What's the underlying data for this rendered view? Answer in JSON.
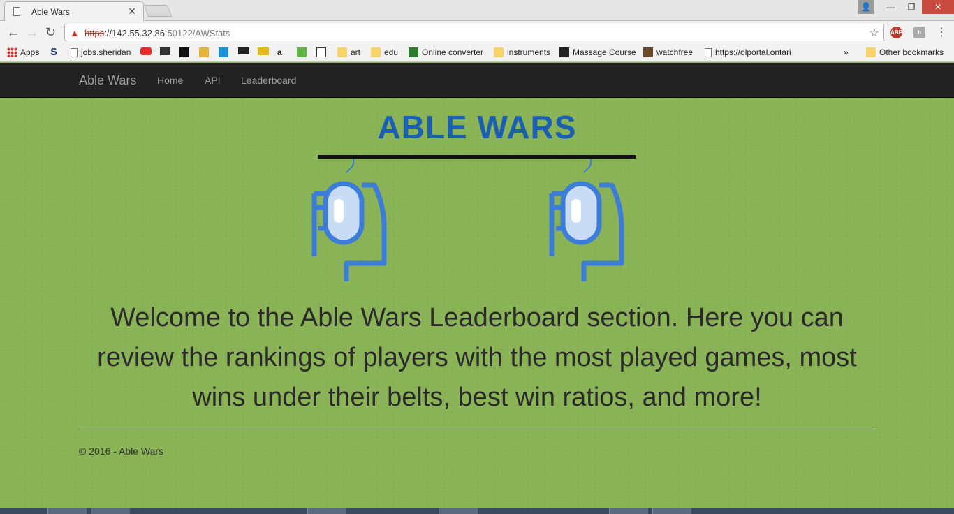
{
  "browser": {
    "tab_title": "Able Wars",
    "url_scheme": "https",
    "url_host": "://142.55.32.86",
    "url_path": ":50122/AWStats",
    "extension_abp": "ABP"
  },
  "bookmarks": [
    {
      "label": "Apps",
      "icon": "apps-grid-icon"
    },
    {
      "label": "jobs.sheridan",
      "icon": "page-icon"
    },
    {
      "label": "art",
      "icon": "folder-icon"
    },
    {
      "label": "edu",
      "icon": "folder-icon"
    },
    {
      "label": "Online converter",
      "icon": "converter-icon"
    },
    {
      "label": "instruments",
      "icon": "folder-icon"
    },
    {
      "label": "Massage Course",
      "icon": "a-icon"
    },
    {
      "label": "watchfree",
      "icon": "film-icon"
    },
    {
      "label": "https://olportal.ontari",
      "icon": "page-icon"
    },
    {
      "label": "»",
      "icon": "overflow-chevron-icon"
    },
    {
      "label": "Other bookmarks",
      "icon": "folder-icon"
    }
  ],
  "navbar": {
    "brand": "Able Wars",
    "links": [
      "Home",
      "API",
      "Leaderboard"
    ]
  },
  "main": {
    "logo_text": "ABLE WARS",
    "welcome": "Welcome to the Able Wars Leaderboard section. Here you can review the rankings of players with the most played games, most wins under their belts, best win ratios, and more!",
    "footer": "© 2016 - Able Wars"
  },
  "colors": {
    "page_bg": "#8ab356",
    "logo": "#1a5fb4",
    "navbar": "#222222",
    "mouse_icon": "#3b7dd8"
  }
}
